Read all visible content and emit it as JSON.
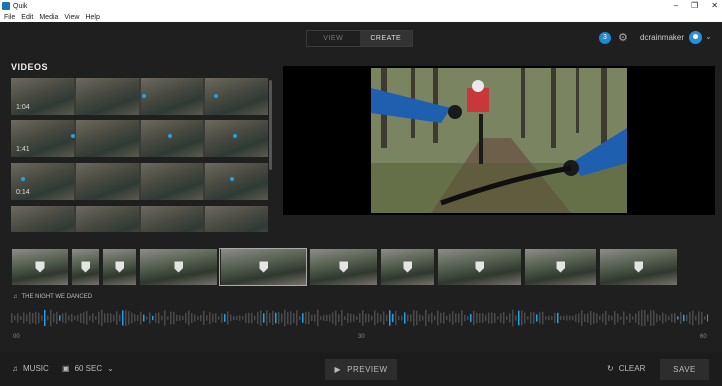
{
  "window": {
    "title": "Quik",
    "controls": [
      "–",
      "❐",
      "✕"
    ]
  },
  "menu": [
    "File",
    "Edit",
    "Media",
    "View",
    "Help"
  ],
  "mode_tabs": [
    {
      "label": "VIEW",
      "active": false
    },
    {
      "label": "CREATE",
      "active": true
    }
  ],
  "header": {
    "notification_count": "3",
    "username": "dcrainmaker"
  },
  "library": {
    "title": "VIDEOS",
    "rows": [
      {
        "duration": "1:04"
      },
      {
        "duration": "1:41"
      },
      {
        "duration": "0:14"
      },
      {
        "duration": ""
      }
    ]
  },
  "timeline": {
    "clip_count": 10,
    "song_title": "THE NIGHT WE DANCED",
    "ticks": [
      "00",
      "30",
      "60"
    ]
  },
  "bottom": {
    "music_label": "MUSIC",
    "duration_label": "60 SEC",
    "preview_label": "PREVIEW",
    "clear_label": "CLEAR",
    "save_label": "SAVE"
  },
  "colors": {
    "accent": "#1fa3e6",
    "background": "#1f1f1f",
    "panel": "#2d2d2d"
  },
  "icons": [
    "app-icon",
    "gear-icon",
    "avatar-icon",
    "chevron-down-icon",
    "music-note-icon",
    "film-icon",
    "play-icon",
    "undo-icon",
    "highlight-tag-icon"
  ]
}
